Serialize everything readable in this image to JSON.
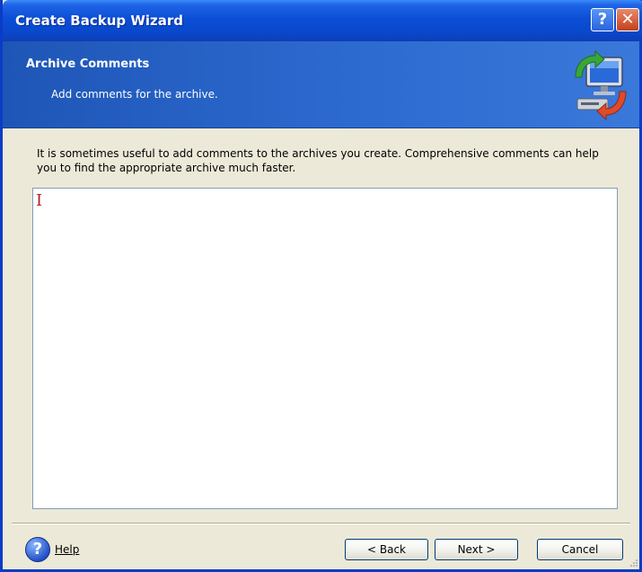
{
  "window": {
    "title": "Create Backup Wizard",
    "help_glyph": "?",
    "close_glyph": "✕"
  },
  "header": {
    "title": "Archive Comments",
    "subtitle": "Add comments for the archive.",
    "icon": "computer-backup-icon"
  },
  "main": {
    "description": "It is sometimes useful to add comments to the archives you create. Comprehensive comments can help you to find the appropriate archive much faster.",
    "comment_value": "",
    "caret_glyph": "I"
  },
  "footer": {
    "help_glyph": "?",
    "help_label": "Help",
    "back_label": "< Back",
    "next_label": "Next >",
    "cancel_label": "Cancel"
  },
  "colors": {
    "title_bar": "#0a47cb",
    "header_band": "#2d6ad0",
    "dialog_face": "#ece9d8",
    "caret": "#b22222"
  }
}
